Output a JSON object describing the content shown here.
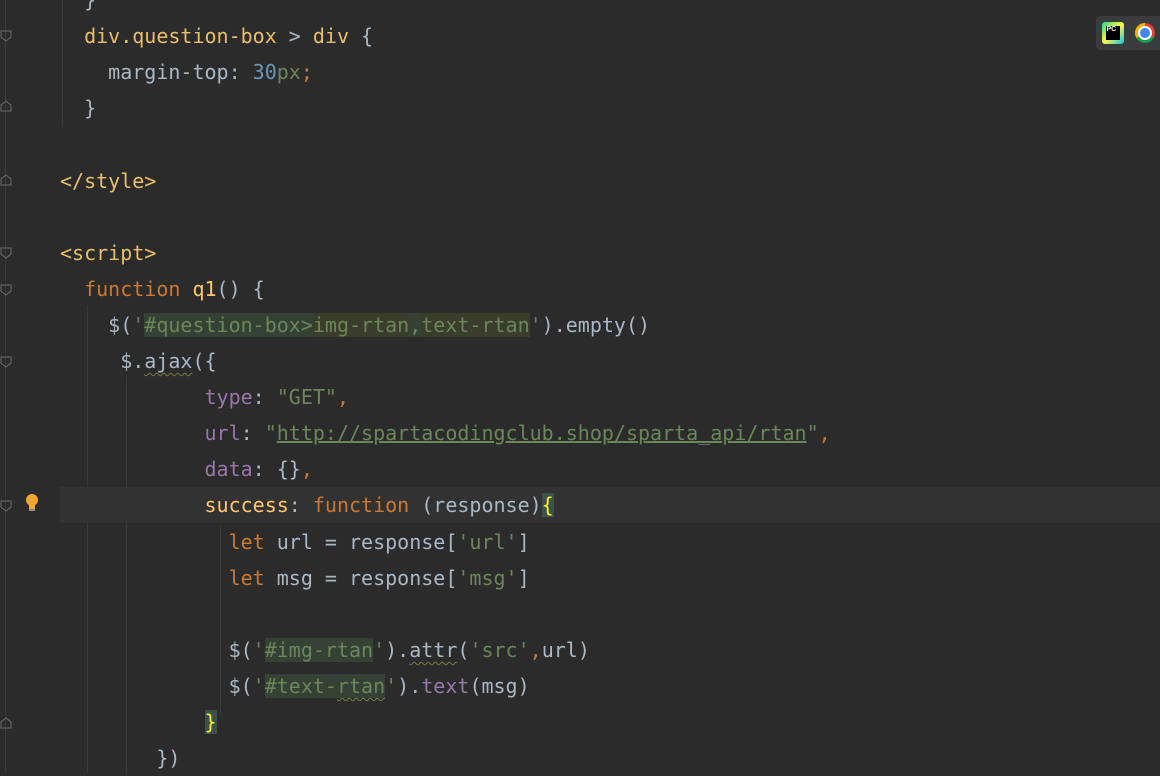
{
  "code_lines": [
    {
      "parts": [
        {
          "c": "plain",
          "t": "  }"
        }
      ]
    },
    {
      "parts": [
        {
          "c": "sel",
          "t": "  div.question-box "
        },
        {
          "c": "plain",
          "t": "> "
        },
        {
          "c": "sel",
          "t": "div "
        },
        {
          "c": "plain",
          "t": "{"
        }
      ]
    },
    {
      "parts": [
        {
          "c": "plain",
          "t": "    margin-top"
        },
        {
          "c": "plain",
          "t": ": "
        },
        {
          "c": "num",
          "t": "30"
        },
        {
          "c": "str",
          "t": "px"
        },
        {
          "c": "punc",
          "t": ";"
        }
      ]
    },
    {
      "parts": [
        {
          "c": "plain",
          "t": "  }"
        }
      ]
    },
    {
      "parts": []
    },
    {
      "parts": [
        {
          "c": "tag",
          "t": "</style>"
        }
      ]
    },
    {
      "parts": []
    },
    {
      "parts": [
        {
          "c": "tag",
          "t": "<script>"
        }
      ]
    },
    {
      "parts": [
        {
          "c": "kw",
          "t": "  function "
        },
        {
          "c": "fn",
          "t": "q1"
        },
        {
          "c": "plain",
          "t": "() {"
        }
      ]
    },
    {
      "parts": [
        {
          "c": "plain",
          "t": "    $("
        },
        {
          "c": "str",
          "t": "'"
        },
        {
          "c": "str hl2",
          "t": "#question-box>"
        },
        {
          "c": "str hl",
          "t": "img-rtan"
        },
        {
          "c": "str hl2",
          "t": ","
        },
        {
          "c": "str hl",
          "t": "text-rtan"
        },
        {
          "c": "str",
          "t": "'"
        },
        {
          "c": "plain",
          "t": ").empty()"
        }
      ]
    },
    {
      "parts": [
        {
          "c": "plain",
          "t": "     $."
        },
        {
          "c": "plain squig",
          "t": "ajax"
        },
        {
          "c": "plain",
          "t": "({"
        }
      ]
    },
    {
      "parts": [
        {
          "c": "prop",
          "t": "            type"
        },
        {
          "c": "plain",
          "t": ": "
        },
        {
          "c": "str",
          "t": "\"GET\""
        },
        {
          "c": "punc",
          "t": ","
        }
      ]
    },
    {
      "parts": [
        {
          "c": "prop",
          "t": "            url"
        },
        {
          "c": "plain",
          "t": ": "
        },
        {
          "c": "str",
          "t": "\""
        },
        {
          "c": "link",
          "t": "http://spartacodingclub.shop/sparta_api/rtan"
        },
        {
          "c": "str",
          "t": "\""
        },
        {
          "c": "punc",
          "t": ","
        }
      ]
    },
    {
      "parts": [
        {
          "c": "prop",
          "t": "            data"
        },
        {
          "c": "plain",
          "t": ": {}"
        },
        {
          "c": "punc",
          "t": ","
        }
      ]
    },
    {
      "parts": [
        {
          "c": "fn",
          "t": "            success"
        },
        {
          "c": "plain",
          "t": ": "
        },
        {
          "c": "kw",
          "t": "function "
        },
        {
          "c": "plain",
          "t": "(response)"
        },
        {
          "c": "brace-hl",
          "t": "{"
        }
      ]
    },
    {
      "parts": [
        {
          "c": "kw",
          "t": "              let "
        },
        {
          "c": "plain",
          "t": "url = response["
        },
        {
          "c": "str",
          "t": "'url'"
        },
        {
          "c": "plain",
          "t": "]"
        }
      ]
    },
    {
      "parts": [
        {
          "c": "kw",
          "t": "              let "
        },
        {
          "c": "plain",
          "t": "msg = response["
        },
        {
          "c": "str",
          "t": "'msg'"
        },
        {
          "c": "plain",
          "t": "]"
        }
      ]
    },
    {
      "parts": []
    },
    {
      "parts": [
        {
          "c": "plain",
          "t": "              $("
        },
        {
          "c": "str",
          "t": "'"
        },
        {
          "c": "str hl2",
          "t": "#img-rtan"
        },
        {
          "c": "str",
          "t": "'"
        },
        {
          "c": "plain",
          "t": ")."
        },
        {
          "c": "plain squig",
          "t": "attr"
        },
        {
          "c": "plain",
          "t": "("
        },
        {
          "c": "str",
          "t": "'src'"
        },
        {
          "c": "punc",
          "t": ","
        },
        {
          "c": "plain",
          "t": "url)"
        }
      ]
    },
    {
      "parts": [
        {
          "c": "plain",
          "t": "              $("
        },
        {
          "c": "str",
          "t": "'"
        },
        {
          "c": "str hl2",
          "t": "#text-"
        },
        {
          "c": "str hl2 squig",
          "t": "rtan"
        },
        {
          "c": "str",
          "t": "'"
        },
        {
          "c": "plain",
          "t": ")."
        },
        {
          "c": "prop",
          "t": "text"
        },
        {
          "c": "plain",
          "t": "(msg)"
        }
      ]
    },
    {
      "parts": [
        {
          "c": "plain",
          "t": "            "
        },
        {
          "c": "brace-hl",
          "t": "}"
        }
      ]
    },
    {
      "parts": [
        {
          "c": "plain",
          "t": "        })"
        }
      ]
    }
  ],
  "current_line_index": 14,
  "toolbar": {
    "pycharm_icon_label": "PC"
  }
}
